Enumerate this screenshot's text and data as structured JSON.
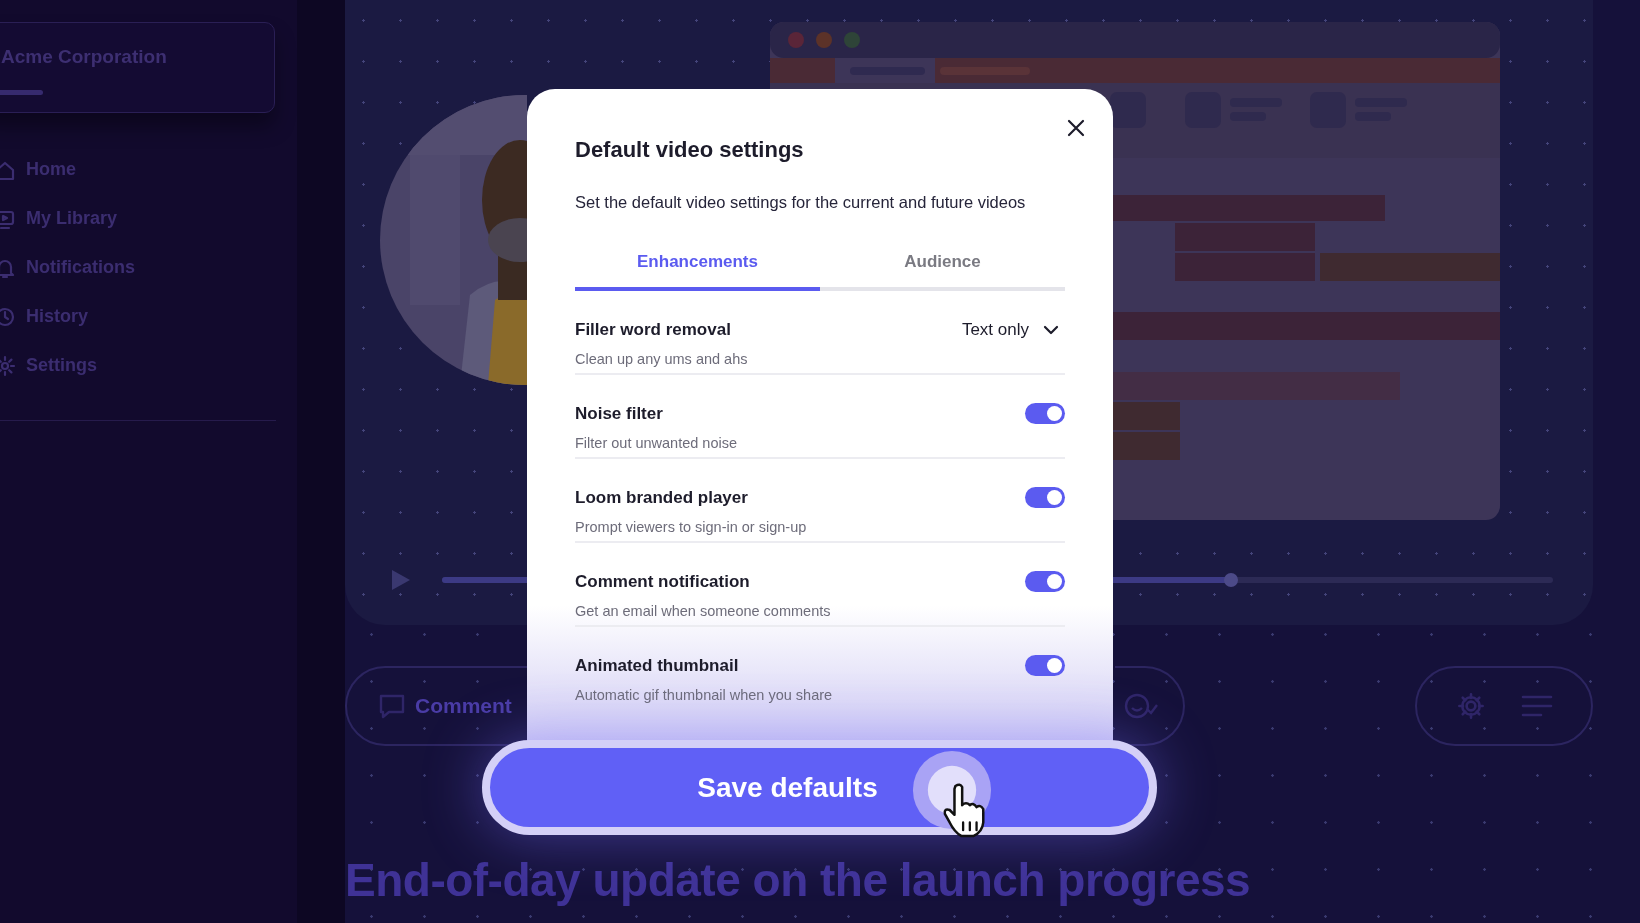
{
  "sidebar": {
    "workspace": "Acme Corporation",
    "items": [
      {
        "label": "Home"
      },
      {
        "label": "My Library"
      },
      {
        "label": "Notifications"
      },
      {
        "label": "History"
      },
      {
        "label": "Settings"
      }
    ]
  },
  "video": {
    "player": {
      "level": 0.71
    },
    "comment_button": "Comment",
    "title": "End-of-day update on the launch progress"
  },
  "modal": {
    "title": "Default video settings",
    "description": "Set the default video settings for the current and future videos",
    "tabs": [
      {
        "label": "Enhancements",
        "selected": true
      },
      {
        "label": "Audience",
        "selected": false
      }
    ],
    "settings": [
      {
        "kind": "select",
        "title": "Filler word removal",
        "description": "Clean up any ums and ahs",
        "value": "Text only"
      },
      {
        "kind": "toggle",
        "title": "Noise filter",
        "description": "Filter out unwanted noise",
        "on": true
      },
      {
        "kind": "toggle",
        "title": "Loom branded player",
        "description": "Prompt viewers to sign-in or sign-up",
        "on": true
      },
      {
        "kind": "toggle",
        "title": "Comment notification",
        "description": "Get an email when someone comments",
        "on": true
      },
      {
        "kind": "toggle",
        "title": "Animated thumbnail",
        "description": "Automatic gif thumbnail when you share",
        "on": true
      }
    ],
    "save_button": "Save defaults"
  }
}
